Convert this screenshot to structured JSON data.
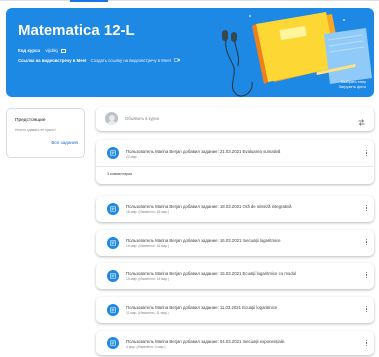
{
  "banner": {
    "title": "Matematica 12-L",
    "course_code_label": "Код курса",
    "course_code_value": "vijcbkj",
    "meet_label": "Ссылка на видеовстречу в Meet",
    "meet_link": "Создать ссылку на видеовстречу в Meet",
    "select_theme": "Выбрать тему",
    "upload_photo": "Загрузить фото"
  },
  "upcoming": {
    "title": "Предстоящие",
    "empty": "Ничего сдавать не нужно!",
    "view_all": "Все задания"
  },
  "announce": {
    "placeholder": "Объявить в курсе"
  },
  "stream": [
    {
      "title": "Пользователь Marina Berjan добавил задание: 21.03.2021 Evaluarea sumativă",
      "date": "22 мар.",
      "comments": "3 комментария"
    },
    {
      "title": "Пользователь Marina Berjan добавил задание: 18.03.2021 Oră de sinteză integrativă",
      "date": "18 мар. (Изменено: 18 мар.)"
    },
    {
      "title": "Пользователь Marina Berjan добавил задание: 16.03.2021 Inecuații logaritmice",
      "date": "16 мар. (Изменено: 16 мар.)"
    },
    {
      "title": "Пользователь Marina Berjan добавил задание: 15.03.2021 Ecuații logaritmice cu modul",
      "date": "15 мар. (Изменено: 15 мар.)"
    },
    {
      "title": "Пользователь Marina Berjan добавил задание: 11.03.2021 Ecuații logaritmice",
      "date": "11 мар. (Изменено: 11 мар.)"
    },
    {
      "title": "Пользователь Marina Berjan добавил задание: 04.03.2021 Inecuații exponențiale.",
      "date": "4 мар. (Изменено: 4 мар.)"
    }
  ],
  "icons": {
    "assignment": "assignment-icon",
    "more": "more-vert-icon",
    "repost": "repost-icon",
    "copy": "copy-icon",
    "camera": "video-camera-icon"
  },
  "colors": {
    "banner": "#1e88e5",
    "accent": "#1a73e8",
    "link": "#1967d2",
    "book": "#fdd835"
  }
}
